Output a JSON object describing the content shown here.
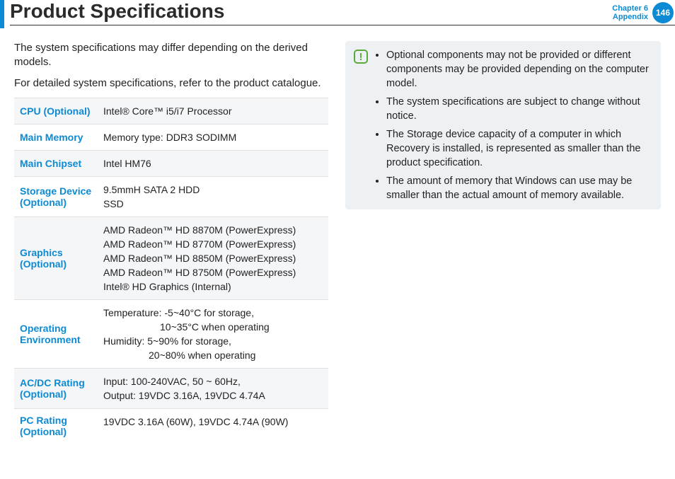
{
  "header": {
    "title": "Product Specifications",
    "chapter_line1": "Chapter 6",
    "chapter_line2": "Appendix",
    "page_number": "146"
  },
  "intro": {
    "p1": "The system specifications may differ depending on the derived models.",
    "p2": "For detailed system specifications, refer to the product catalogue."
  },
  "specs": [
    {
      "label": "CPU (Optional)",
      "lines": [
        "Intel® Core™ i5/i7 Processor"
      ]
    },
    {
      "label": "Main Memory",
      "lines": [
        "Memory type: DDR3 SODIMM"
      ]
    },
    {
      "label": "Main Chipset",
      "lines": [
        "Intel HM76"
      ]
    },
    {
      "label": "Storage Device (Optional)",
      "lines": [
        "9.5mmH SATA 2 HDD",
        "SSD"
      ]
    },
    {
      "label": "Graphics (Optional)",
      "lines": [
        "AMD Radeon™ HD 8870M (PowerExpress)",
        "AMD Radeon™ HD 8770M (PowerExpress)",
        "AMD Radeon™ HD 8850M (PowerExpress)",
        "AMD Radeon™ HD 8750M (PowerExpress)",
        "Intel® HD Graphics (Internal)"
      ]
    },
    {
      "label": "Operating Environment",
      "env": {
        "temp1": "Temperature: -5~40°C for storage,",
        "temp2": "10~35°C when operating",
        "hum1": "Humidity: 5~90% for storage,",
        "hum2": "20~80% when operating"
      }
    },
    {
      "label": "AC/DC Rating (Optional)",
      "lines": [
        "Input: 100-240VAC, 50 ~ 60Hz,",
        "Output: 19VDC 3.16A, 19VDC 4.74A"
      ]
    },
    {
      "label": "PC Rating (Optional)",
      "lines": [
        "19VDC 3.16A (60W), 19VDC 4.74A (90W)"
      ]
    }
  ],
  "notice": {
    "items": [
      "Optional components may not be provided or different components may be provided depending on the computer model.",
      "The system specifications are subject to change without notice.",
      "The Storage device capacity of a computer in which Recovery is installed, is represented as smaller than the product specification.",
      "The amount of memory that Windows can use may be smaller than the actual amount of memory available."
    ]
  }
}
